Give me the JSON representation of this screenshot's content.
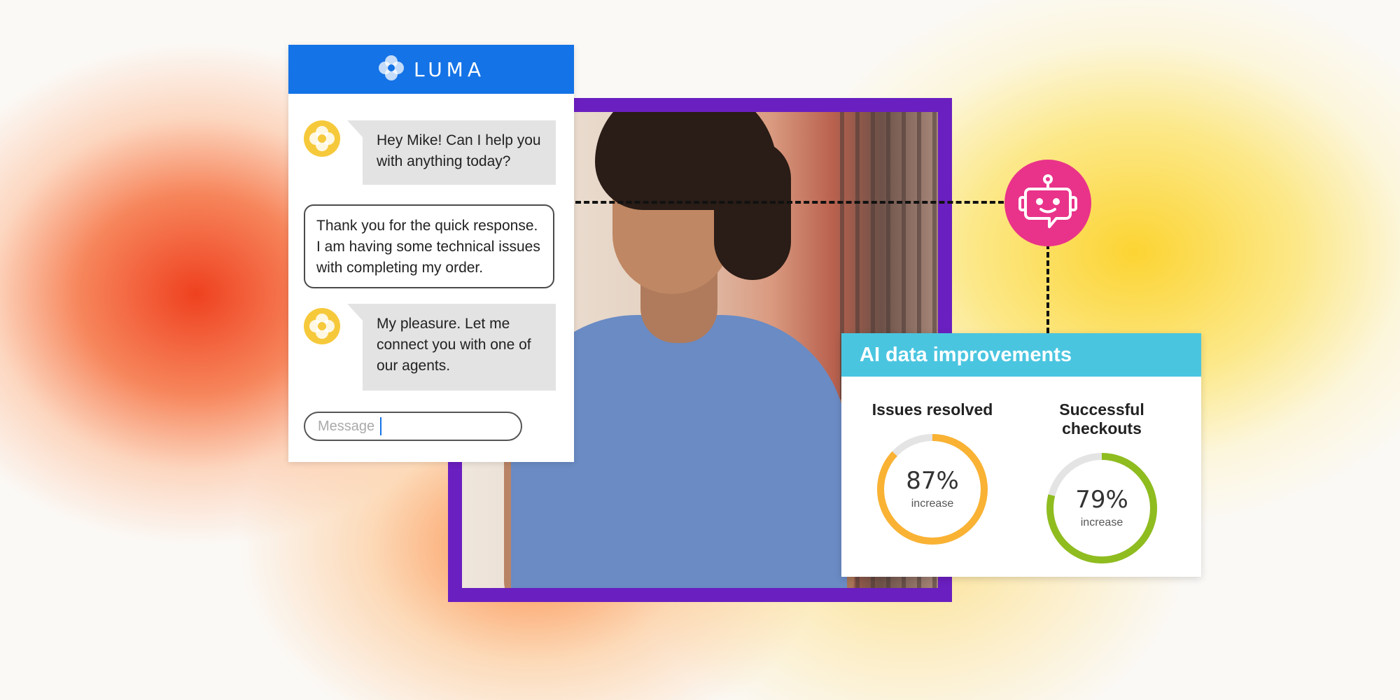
{
  "brand": {
    "name": "LUMA"
  },
  "chat": {
    "messages": [
      {
        "from": "bot",
        "text": "Hey Mike! Can I help you with anything today?"
      },
      {
        "from": "user",
        "text": "Thank you for the quick response. I am having some technical issues with completing my order."
      },
      {
        "from": "bot",
        "text": "My pleasure. Let me connect you with one of our agents."
      }
    ],
    "input_placeholder": "Message"
  },
  "stats_panel": {
    "title": "AI data improvements",
    "stats": [
      {
        "label": "Issues resolved",
        "value": "87%",
        "sub": "increase",
        "fraction": 0.87,
        "color": "#f9b233"
      },
      {
        "label": "Successful checkouts",
        "value": "79%",
        "sub": "increase",
        "fraction": 0.79,
        "color": "#8fbc1f"
      }
    ]
  },
  "colors": {
    "chat_header": "#1473e6",
    "frame": "#6a1fc0",
    "bot_icon_bg": "#e9338a",
    "stats_header": "#4ac5e0"
  },
  "icons": [
    "luma-logo-icon",
    "bot-avatar-icon",
    "robot-chat-icon"
  ]
}
